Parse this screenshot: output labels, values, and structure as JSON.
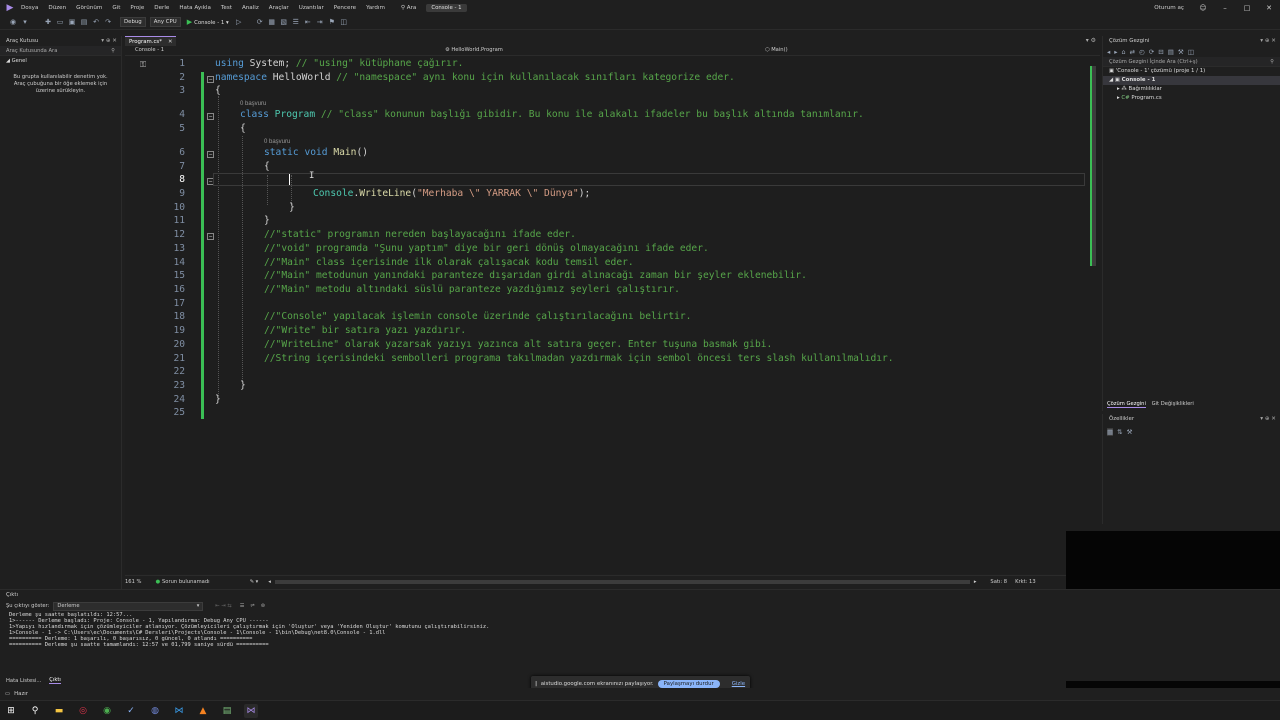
{
  "menubar": {
    "items": [
      "Dosya",
      "Düzen",
      "Görünüm",
      "Git",
      "Proje",
      "Derle",
      "Hata Ayıkla",
      "Test",
      "Analiz",
      "Araçlar",
      "Uzantılar",
      "Pencere",
      "Yardım"
    ],
    "search_label": "Ara",
    "solution_name": "Console - 1",
    "signin": "Oturum aç"
  },
  "toolbar": {
    "config": "Debug",
    "platform": "Any CPU",
    "run_label": "Console - 1"
  },
  "toolbox": {
    "title": "Araç Kutusu",
    "search_placeholder": "Araç Kutusunda Ara",
    "group": "Genel",
    "empty_message": "Bu grupta kullanılabilir denetim yok. Araç çubuğuna bir öğe eklemek için üzerine sürükleyin."
  },
  "editor": {
    "tab_label": "Program.cs*",
    "project_label": "Console - 1",
    "nav_class": "HelloWorld.Program",
    "nav_member": "Main()",
    "codelens": "0 başvuru",
    "line_numbers": [
      "1",
      "2",
      "3",
      "4",
      "5",
      "6",
      "7",
      "8",
      "9",
      "10",
      "11",
      "12",
      "13",
      "14",
      "15",
      "16",
      "17",
      "18",
      "19",
      "20",
      "21",
      "22",
      "23",
      "24",
      "25"
    ],
    "code": {
      "l1_kw": "using",
      "l1_rest": " System; ",
      "l1_comment": "// \"using\" kütüphane çağırır.",
      "l2_kw": "namespace",
      "l2_name": " HelloWorld ",
      "l2_comment": "// \"namespace\" aynı konu için kullanılacak sınıfları kategorize eder.",
      "l3": "{",
      "l4_kw": "class",
      "l4_name": " Program ",
      "l4_comment": "// \"class\" konunun başlığı gibidir. Bu konu ile alakalı ifadeler bu başlık altında tanımlanır.",
      "l5": "{",
      "l6_kw1": "static",
      "l6_kw2": "void",
      "l6_fn": "Main",
      "l6_paren": "()",
      "l7": "{",
      "l9_cls": "Console",
      "l9_dot": ".",
      "l9_fn": "WriteLine",
      "l9_open": "(",
      "l9_str": "\"Merhaba \\\" YARRAK \\\" Dünya\"",
      "l9_close": ");",
      "l10": "}",
      "l11": "}",
      "l12": "//\"static\" programın nereden başlayacağını ifade eder.",
      "l13": "//\"void\" programda \"Şunu yaptım\" diye bir geri dönüş olmayacağını ifade eder.",
      "l14": "//\"Main\" class içerisinde ilk olarak çalışacak kodu temsil eder.",
      "l15": "//\"Main\" metodunun yanındaki paranteze dışarıdan girdi alınacağı zaman bir şeyler eklenebilir.",
      "l16": "//\"Main\" metodu altındaki süslü paranteze yazdığımız şeyleri çalıştırır.",
      "l18": "//\"Console\" yapılacak işlemin console üzerinde çalıştırılacağını belirtir.",
      "l19": "//\"Write\" bir satıra yazı yazdırır.",
      "l20": "//\"WriteLine\" olarak yazarsak yazıyı yazınca alt satıra geçer. Enter tuşuna basmak gibi.",
      "l21": "//String içerisindeki sembolleri programa takılmadan yazdırmak için sembol öncesi ters slash kullanılmalıdır.",
      "l23": "}",
      "l24": "}"
    },
    "zoom": "161 %",
    "issues": "Sorun bulunamadı",
    "line_info": "Satı: 8",
    "char_info": "Krkt: 13"
  },
  "solution_explorer": {
    "title": "Çözüm Gezgini",
    "search_placeholder": "Çözüm Gezgini İçinde Ara (Ctrl+ş)",
    "solution_node": "'Console - 1' çözümü (proje 1 / 1)",
    "project_node": "Console - 1",
    "deps_node": "Bağımlılıklar",
    "file_node": "Program.cs",
    "tab1": "Çözüm Gezgini",
    "tab2": "Git Değişiklikleri"
  },
  "properties": {
    "title": "Özellikler"
  },
  "output": {
    "title": "Çıktı",
    "show_label": "Şu çıktıyı göster:",
    "source": "Derleme",
    "lines": [
      "Derleme şu saatte başlatıldı: 12:57...",
      "1>------ Derleme başladı: Proje: Console - 1, Yapılandırma: Debug Any CPU ------",
      "1>Yapıyı hızlandırmak için çözümleyiciler atlanıyor. Çözümleyicileri çalıştırmak için 'Oluştur' veya 'Yeniden Oluştur' komutunu çalıştırabilirsiniz.",
      "1>Console - 1 -> C:\\Users\\ec\\Documents\\C# Dersleri\\Projects\\Console - 1\\Console - 1\\bin\\Debug\\net8.0\\Console - 1.dll",
      "========== Derleme: 1 başarılı, 0 başarısız, 0 güncel, 0 atlandı ==========",
      "========== Derleme şu saatte tamamlandı: 12:57 ve 01,799 saniye sürdü =========="
    ]
  },
  "bottom_tabs": [
    "Hata Listesi...",
    "Çıktı"
  ],
  "share_bar": {
    "message": "aistudio.google.com ekranınızı paylaşıyor.",
    "stop_label": "Paylaşmayı durdur",
    "hide_label": "Gizle"
  },
  "statusbar": {
    "ready": "Hazır"
  },
  "taskbar": {
    "icons": [
      "windows-icon",
      "search-icon",
      "file-explorer-icon",
      "opera-gx-icon",
      "chrome-icon",
      "vscode-icon",
      "discord-icon",
      "visual-studio-code-icon",
      "vlc-icon",
      "notepad-icon",
      "visual-studio-icon"
    ]
  },
  "colors": {
    "accent": "#a98ce8",
    "keyword": "#569cd6",
    "class": "#4ec9b0",
    "comment": "#57a64a",
    "string": "#d69d85",
    "function": "#dcdcaa"
  }
}
